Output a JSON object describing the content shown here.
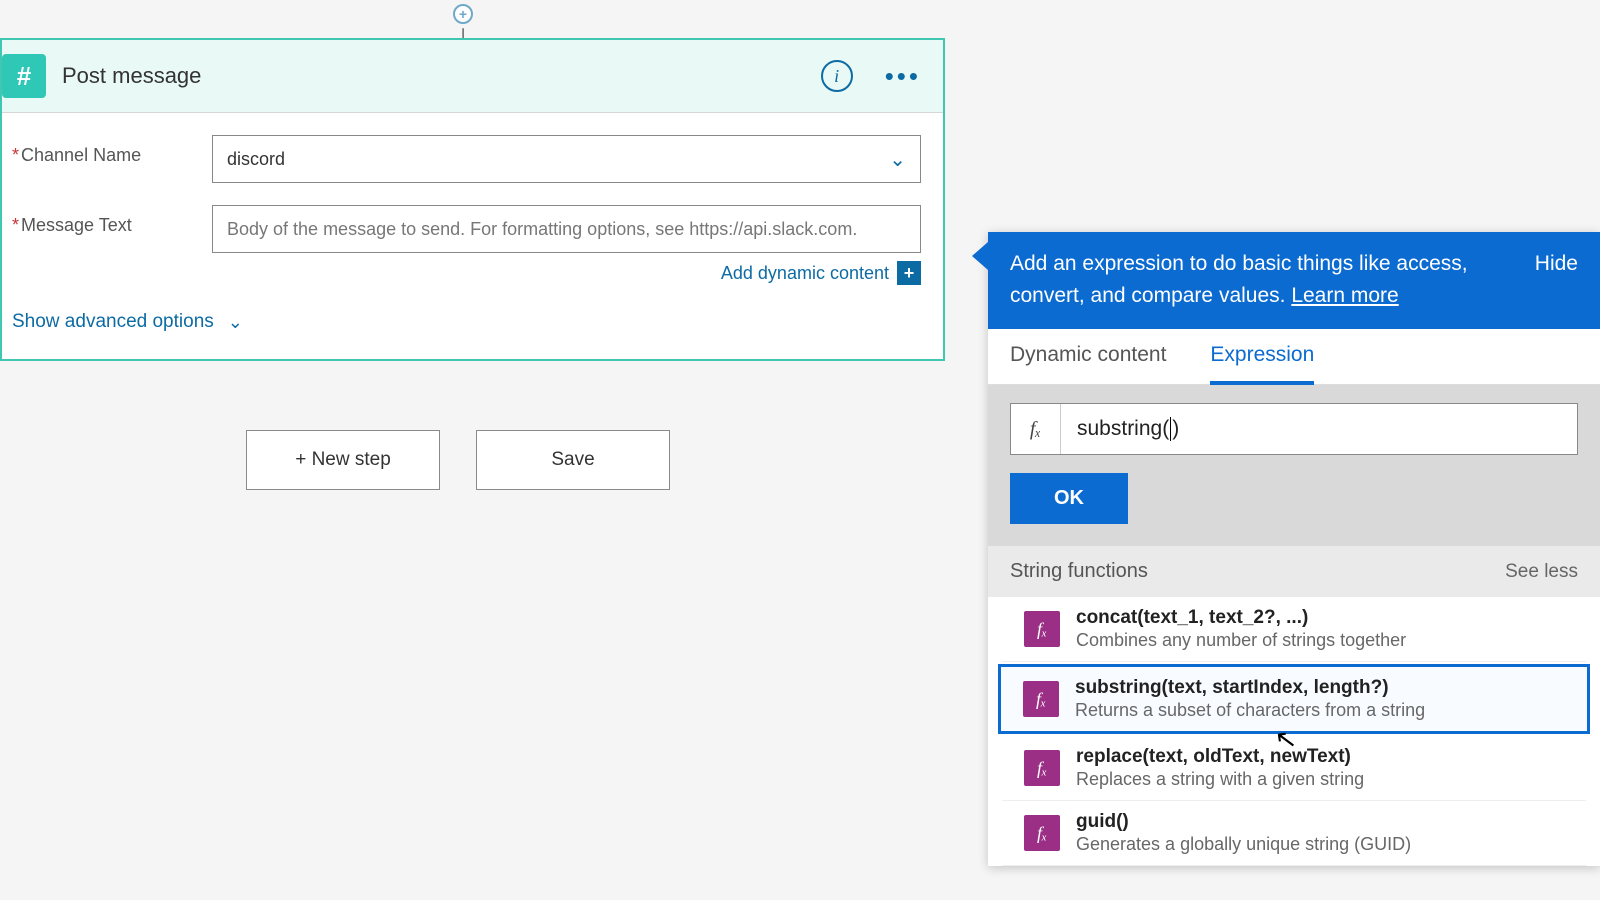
{
  "card": {
    "title": "Post message",
    "app_icon_glyph": "#",
    "fields": {
      "channel_label": "Channel Name",
      "channel_value": "discord",
      "message_label": "Message Text",
      "message_placeholder": "Body of the message to send. For formatting options, see https://api.slack.com."
    },
    "add_dynamic": "Add dynamic content",
    "advanced": "Show advanced options"
  },
  "buttons": {
    "new_step": "+ New step",
    "save": "Save"
  },
  "flyout": {
    "banner_text": "Add an expression to do basic things like access, convert, and compare values. ",
    "learn_more": "Learn more",
    "hide": "Hide",
    "tabs": {
      "dynamic": "Dynamic content",
      "expression": "Expression"
    },
    "expr_value_before": "substring(",
    "expr_value_after": ")",
    "fx_glyph": "fₓ",
    "ok": "OK",
    "group": {
      "title": "String functions",
      "toggle": "See less"
    },
    "functions": [
      {
        "sig": "concat(text_1, text_2?, ...)",
        "desc": "Combines any number of strings together",
        "selected": false
      },
      {
        "sig": "substring(text, startIndex, length?)",
        "desc": "Returns a subset of characters from a string",
        "selected": true
      },
      {
        "sig": "replace(text, oldText, newText)",
        "desc": "Replaces a string with a given string",
        "selected": false
      },
      {
        "sig": "guid()",
        "desc": "Generates a globally unique string (GUID)",
        "selected": false
      }
    ]
  }
}
